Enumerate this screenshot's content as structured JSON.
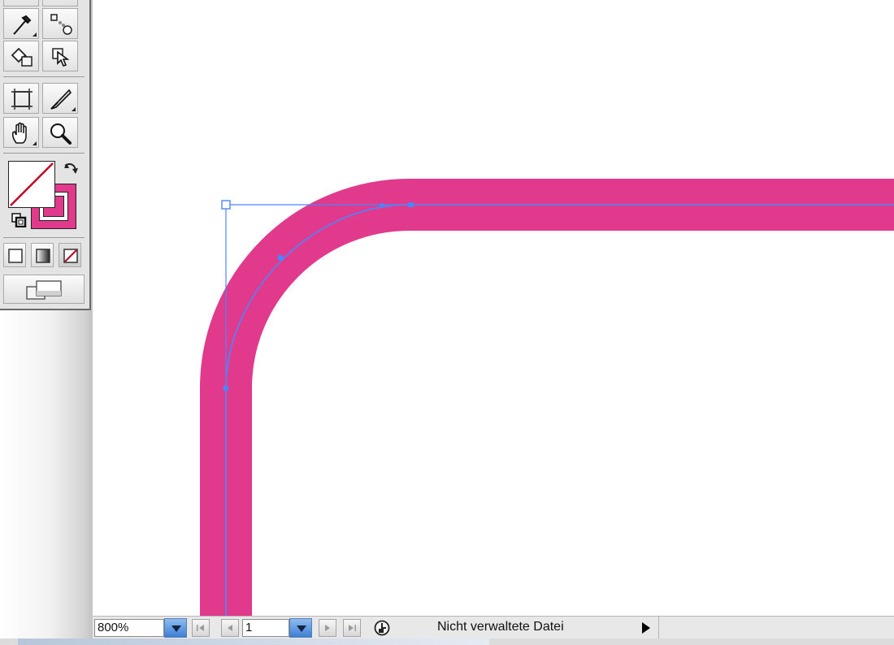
{
  "app": {
    "accent_color": "#e13a8d",
    "selection_color": "#4a86ff"
  },
  "toolbox": {
    "tools": [
      {
        "name": "eyedropper-icon"
      },
      {
        "name": "blend-icon"
      },
      {
        "name": "live-paint-bucket-icon"
      },
      {
        "name": "live-paint-selection-icon"
      },
      {
        "name": "artboard-icon"
      },
      {
        "name": "slice-icon"
      },
      {
        "name": "hand-icon"
      },
      {
        "name": "zoom-icon"
      }
    ],
    "fill_stroke": {
      "fill": "none",
      "stroke_color": "#e13a8d"
    }
  },
  "statusbar": {
    "zoom_value": "800%",
    "page_value": "1",
    "status_text": "Nicht verwaltete Datei"
  }
}
